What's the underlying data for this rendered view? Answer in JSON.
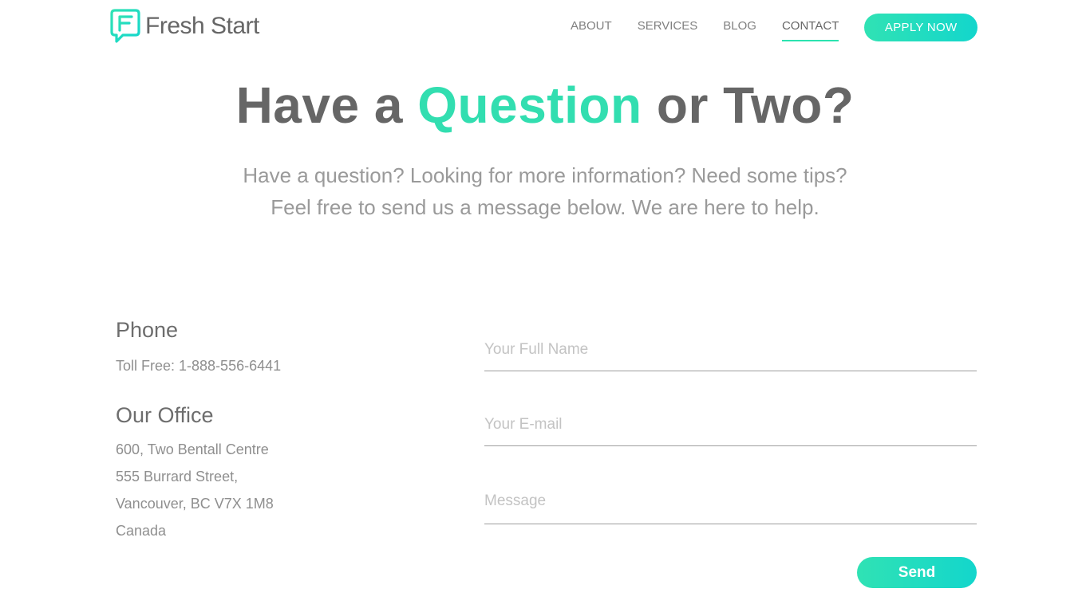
{
  "header": {
    "logo_text": "Fresh Start",
    "logo_icon": "speech-bubble-f-icon",
    "nav": [
      {
        "label": "ABOUT"
      },
      {
        "label": "SERVICES"
      },
      {
        "label": "BLOG"
      },
      {
        "label": "CONTACT",
        "active": true
      }
    ],
    "apply_label": "APPLY NOW"
  },
  "hero": {
    "title_before": "Have a ",
    "title_accent": "Question",
    "title_after": " or Two?",
    "subtext_line1": "Have a question? Looking for more information? Need some tips?",
    "subtext_line2": "Feel free to send us a message below. We are here to help."
  },
  "contact_info": {
    "phone_heading": "Phone",
    "phone_line": "Toll Free: 1-888-556-6441",
    "office_heading": "Our Office",
    "address": [
      "600, Two Bentall Centre",
      "555 Burrard Street,",
      "Vancouver, BC V7X 1M8",
      "Canada"
    ]
  },
  "form": {
    "name_placeholder": "Your Full Name",
    "email_placeholder": "Your E-mail",
    "message_placeholder": "Message",
    "send_label": "Send"
  },
  "colors": {
    "accent": "#32deb0",
    "button_gradient_start": "#30e2b4",
    "button_gradient_end": "#13d6cc",
    "text_dark": "#666666",
    "text_light": "#9a9a9a"
  }
}
